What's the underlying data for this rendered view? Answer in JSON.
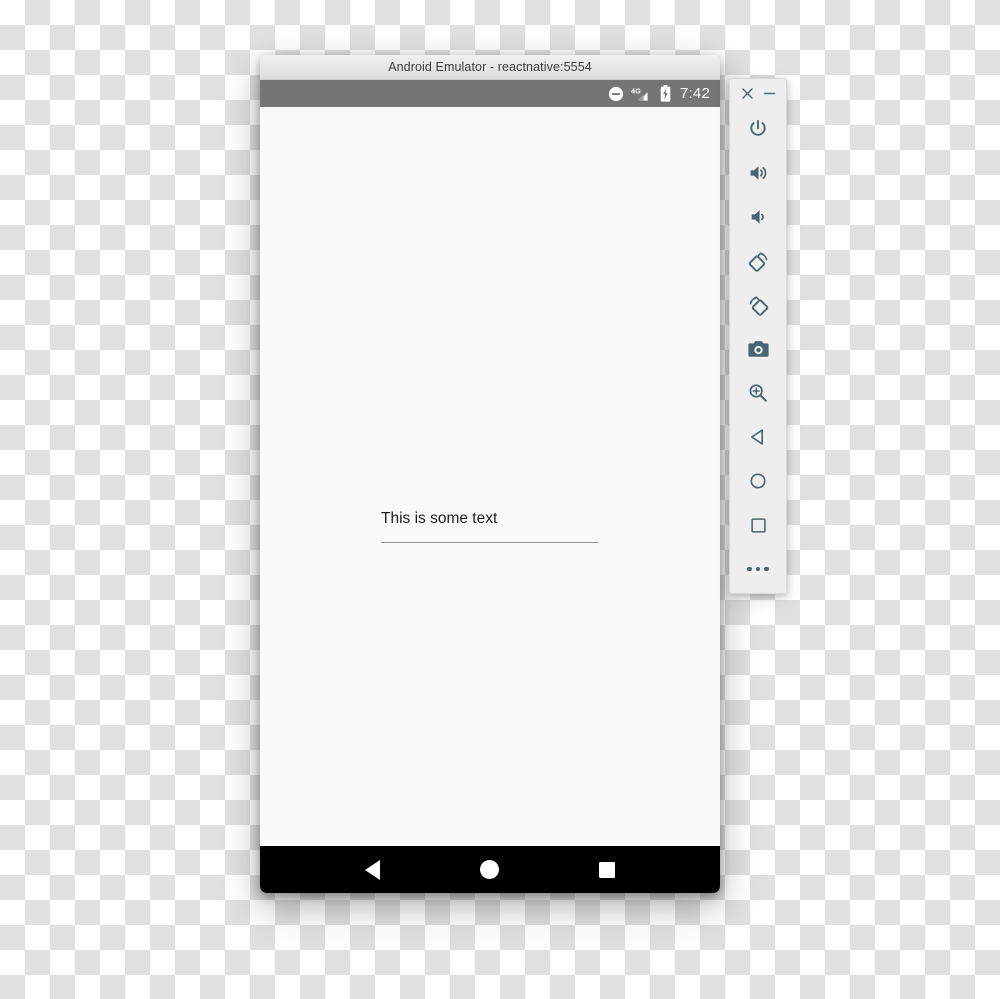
{
  "window": {
    "title": "Android Emulator - reactnative:5554"
  },
  "status_bar": {
    "icons": [
      "do-not-disturb-icon",
      "signal-4g-icon",
      "battery-charging-icon"
    ],
    "network_label": "4G",
    "clock": "7:42"
  },
  "app": {
    "text_input": {
      "value": "This is some text",
      "placeholder": "This is some text"
    }
  },
  "nav_bar": {
    "buttons": [
      {
        "name": "back",
        "icon": "triangle-back-icon"
      },
      {
        "name": "home",
        "icon": "circle-home-icon"
      },
      {
        "name": "overview",
        "icon": "square-overview-icon"
      }
    ]
  },
  "toolbar": {
    "window_controls": [
      {
        "name": "close",
        "glyph": "×"
      },
      {
        "name": "minimize",
        "glyph": "−"
      }
    ],
    "items": [
      {
        "name": "power",
        "icon": "power-icon"
      },
      {
        "name": "volume-up",
        "icon": "volume-up-icon"
      },
      {
        "name": "volume-down",
        "icon": "volume-down-icon"
      },
      {
        "name": "rotate-left",
        "icon": "rotate-left-icon"
      },
      {
        "name": "rotate-right",
        "icon": "rotate-right-icon"
      },
      {
        "name": "screenshot",
        "icon": "camera-icon"
      },
      {
        "name": "zoom",
        "icon": "magnifier-zoom-in-icon"
      },
      {
        "name": "back",
        "icon": "triangle-back-icon"
      },
      {
        "name": "home",
        "icon": "circle-home-icon"
      },
      {
        "name": "overview",
        "icon": "square-overview-icon"
      },
      {
        "name": "more",
        "icon": "more-dots-icon"
      }
    ]
  },
  "colors": {
    "titlebar": "#e8e8e8",
    "status_bar": "#757575",
    "app_background": "#fafafa",
    "nav_bar": "#000000",
    "toolbar_background": "#eeeeee",
    "toolbar_icon": "#4a6572",
    "input_underline": "#8f8f8f",
    "checker_light": "#ffffff",
    "checker_dark": "#e0e0e0"
  }
}
